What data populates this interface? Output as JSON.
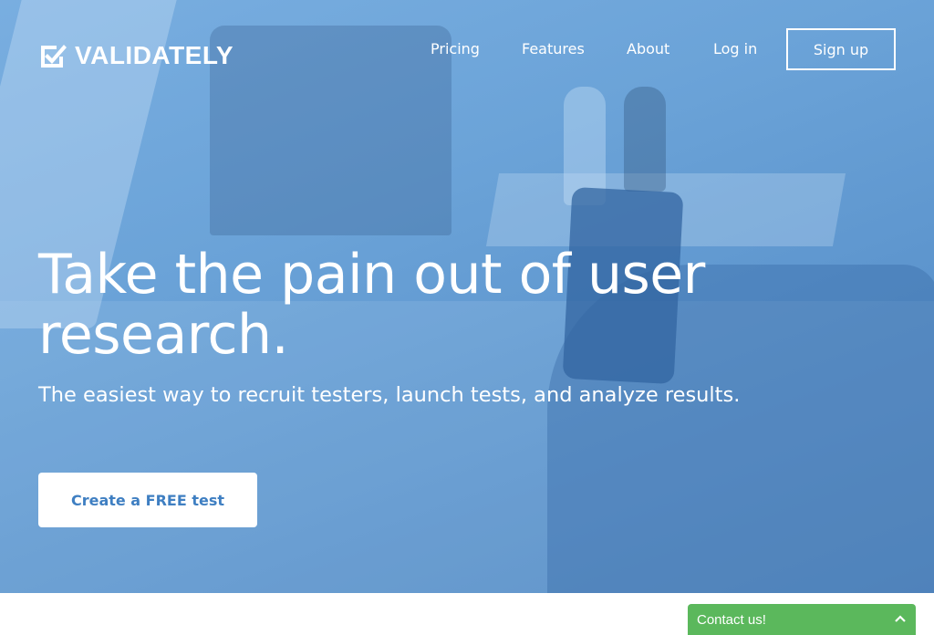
{
  "brand": {
    "name": "VALIDATELY",
    "icon": "checkbox-check-icon"
  },
  "nav": {
    "items": [
      {
        "label": "Pricing"
      },
      {
        "label": "Features"
      },
      {
        "label": "About"
      },
      {
        "label": "Log in"
      }
    ],
    "signup_label": "Sign up"
  },
  "hero": {
    "headline": "Take the pain out of user research.",
    "subhead": "The easiest way to recruit testers, launch tests, and analyze results.",
    "cta_label": "Create a FREE test"
  },
  "contact_widget": {
    "label": "Contact us!",
    "icon": "chevron-up-icon"
  },
  "colors": {
    "hero_overlay": "#6ba3d8",
    "cta_text": "#3f7fc2",
    "contact_green": "#5bb85c",
    "white": "#ffffff"
  }
}
